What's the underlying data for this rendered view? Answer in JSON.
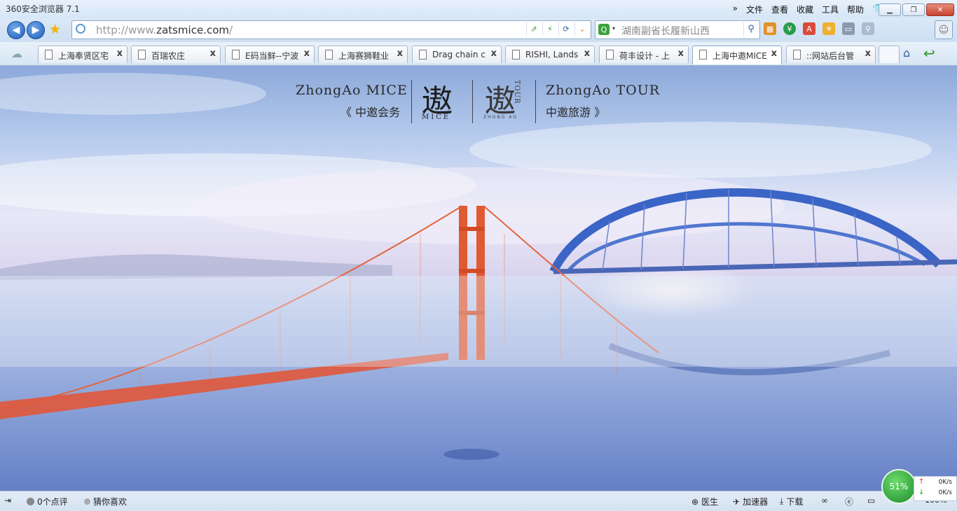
{
  "window": {
    "app_title": "360安全浏览器 7.1",
    "menu": [
      "文件",
      "查看",
      "收藏",
      "工具",
      "帮助"
    ],
    "more_glyph": "»"
  },
  "nav": {
    "url_prefix": "http://www.",
    "url_domain": "zatsmice.com",
    "url_suffix": "/",
    "search_placeholder": "湖南副省长履新山西"
  },
  "tabs": [
    {
      "label": "上海奉贤区宅",
      "active": false
    },
    {
      "label": "百瑞农庄",
      "active": false
    },
    {
      "label": "E码当鲜--宁波",
      "active": false
    },
    {
      "label": "上海赛狮鞋业",
      "active": false
    },
    {
      "label": "Drag chain c",
      "active": false
    },
    {
      "label": "RISHI, Lands",
      "active": false
    },
    {
      "label": "荷丰设计 - 上",
      "active": false
    },
    {
      "label": "上海中邀MICE",
      "active": true
    },
    {
      "label": "::网站后台管",
      "active": false
    }
  ],
  "tab_close_glyph": "x",
  "hero": {
    "left_en": "ZhongAo MICE",
    "left_cn": "《 中邀会务",
    "seal_glyph": "遨",
    "seal_caption": "MICE",
    "seal2_glyph": "遨",
    "seal2_caption": "TOUR",
    "seal2_sub": "ZHONG AO",
    "right_en": "ZhongAo TOUR",
    "right_cn": "中邀旅游 》"
  },
  "status": {
    "comments": "0个点评",
    "guess": "猜你喜欢",
    "doctor": "医生",
    "accelerator": "加速器",
    "download": "下载",
    "zoom": "100%"
  },
  "speed": {
    "percent": "51%",
    "up": "0K/s",
    "down": "0K/s"
  }
}
